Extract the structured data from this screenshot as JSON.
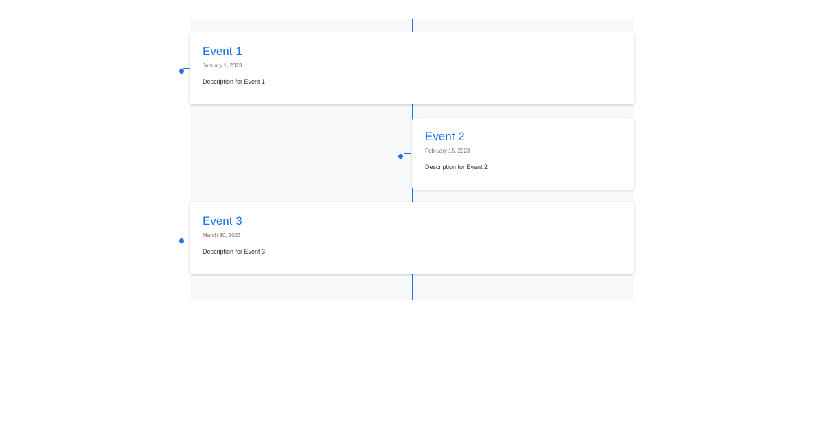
{
  "timeline": {
    "accent_color": "#1a73e8",
    "events": [
      {
        "title": "Event 1",
        "date": "January 1, 2023",
        "description": "Description for Event 1",
        "side": "left"
      },
      {
        "title": "Event 2",
        "date": "February 15, 2023",
        "description": "Description for Event 2",
        "side": "right"
      },
      {
        "title": "Event 3",
        "date": "March 30, 2023",
        "description": "Description for Event 3",
        "side": "left"
      }
    ]
  }
}
